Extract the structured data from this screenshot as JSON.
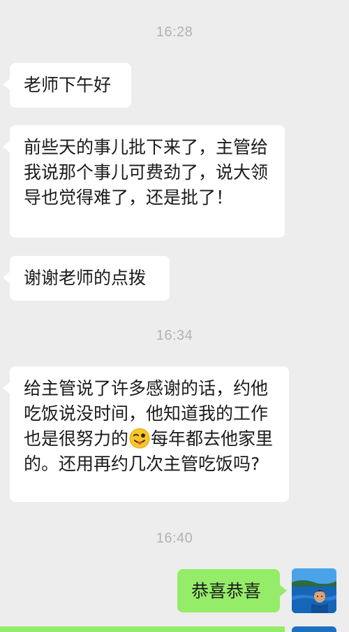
{
  "conversation": {
    "messages": [
      {
        "kind": "timestamp",
        "text": "16:28"
      },
      {
        "kind": "incoming",
        "text": "老师下午好"
      },
      {
        "kind": "incoming",
        "text": "前些天的事儿批下来了，主管给我说那个事儿可费劲了，说大领导也觉得难了，还是批了！"
      },
      {
        "kind": "incoming",
        "text": "谢谢老师的点拨"
      },
      {
        "kind": "timestamp",
        "text": "16:34"
      },
      {
        "kind": "incoming",
        "text_before_emoji": "给主管说了许多感谢的话，约他吃饭说没时间，他知道我的工作也是很努力的",
        "emoji": "winking-face-with-tongue",
        "text_after_emoji": "每年都去他家里的。还用再约几次主管吃饭吗?"
      },
      {
        "kind": "timestamp",
        "text": "16:40"
      },
      {
        "kind": "outgoing",
        "text": "恭喜恭喜"
      }
    ]
  },
  "colors": {
    "background": "#ededed",
    "incoming_bubble": "#ffffff",
    "outgoing_bubble": "#95ec69",
    "timestamp_text": "#b2b2b2",
    "message_text": "#1b1b1b"
  }
}
